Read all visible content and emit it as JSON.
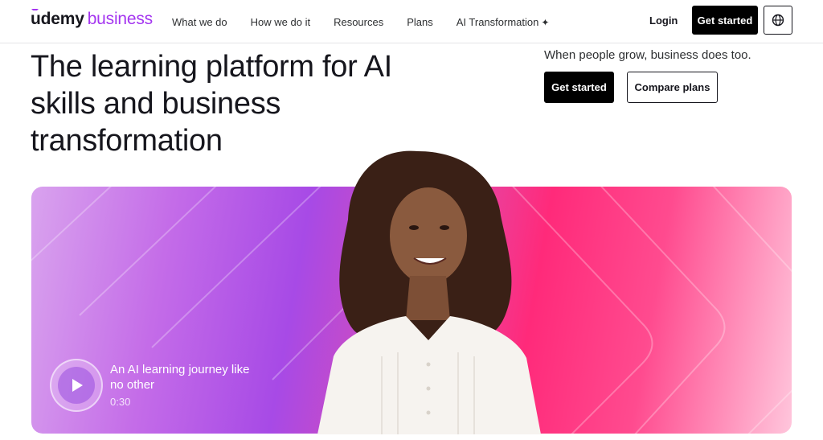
{
  "header": {
    "logo_brand": "udemy",
    "logo_product": "business",
    "nav": [
      {
        "label": "What we do"
      },
      {
        "label": "How we do it"
      },
      {
        "label": "Resources"
      },
      {
        "label": "Plans"
      },
      {
        "label": "AI Transformation",
        "icon": "sparkle-icon"
      }
    ],
    "login_label": "Login",
    "get_started_label": "Get started",
    "globe_icon": "globe-icon"
  },
  "hero": {
    "title": "The learning platform for AI skills and business transformation",
    "subtitle": "When people grow, business does too.",
    "primary_button": "Get started",
    "secondary_button": "Compare plans"
  },
  "video": {
    "title": "An AI learning journey like no other",
    "duration": "0:30",
    "play_icon": "play-icon"
  },
  "colors": {
    "brand_purple": "#a435f0",
    "black": "#000000",
    "banner_pink": "#ff2a7a",
    "banner_purple": "#a74ae6"
  }
}
